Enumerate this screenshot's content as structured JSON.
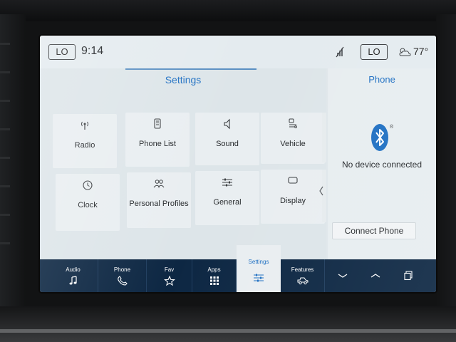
{
  "status_bar": {
    "left_climate": "LO",
    "time": "9:14",
    "right_climate": "LO",
    "outside_temp": "77°"
  },
  "settings": {
    "title": "Settings",
    "tiles": [
      {
        "label": "Radio",
        "icon": "radio-icon"
      },
      {
        "label": "Phone List",
        "icon": "phone-list-icon"
      },
      {
        "label": "Sound",
        "icon": "speaker-icon"
      },
      {
        "label": "Vehicle",
        "icon": "vehicle-settings-icon"
      },
      {
        "label": "Clock",
        "icon": "clock-icon"
      },
      {
        "label": "Personal Profiles",
        "icon": "people-icon"
      },
      {
        "label": "General",
        "icon": "sliders-icon"
      },
      {
        "label": "Display",
        "icon": "display-icon"
      }
    ],
    "page_dots": {
      "count": 2,
      "active": 0
    }
  },
  "phone": {
    "title": "Phone",
    "status": "No device connected",
    "connect_label": "Connect Phone"
  },
  "bottom_nav": {
    "items": [
      {
        "label": "Audio",
        "icon": "music-note-icon"
      },
      {
        "label": "Phone",
        "icon": "phone-icon"
      },
      {
        "label": "Fav",
        "icon": "star-icon"
      },
      {
        "label": "Apps",
        "icon": "grid-icon"
      },
      {
        "label": "Settings",
        "icon": "sliders-icon",
        "active": true
      },
      {
        "label": "Features",
        "icon": "truck-icon"
      }
    ],
    "controls": [
      "chevron-down-icon",
      "chevron-up-icon",
      "windows-icon"
    ]
  },
  "colors": {
    "accent": "#1e6fc2",
    "nav_background": "#0d2743",
    "screen_background": "#dfe6ea"
  }
}
